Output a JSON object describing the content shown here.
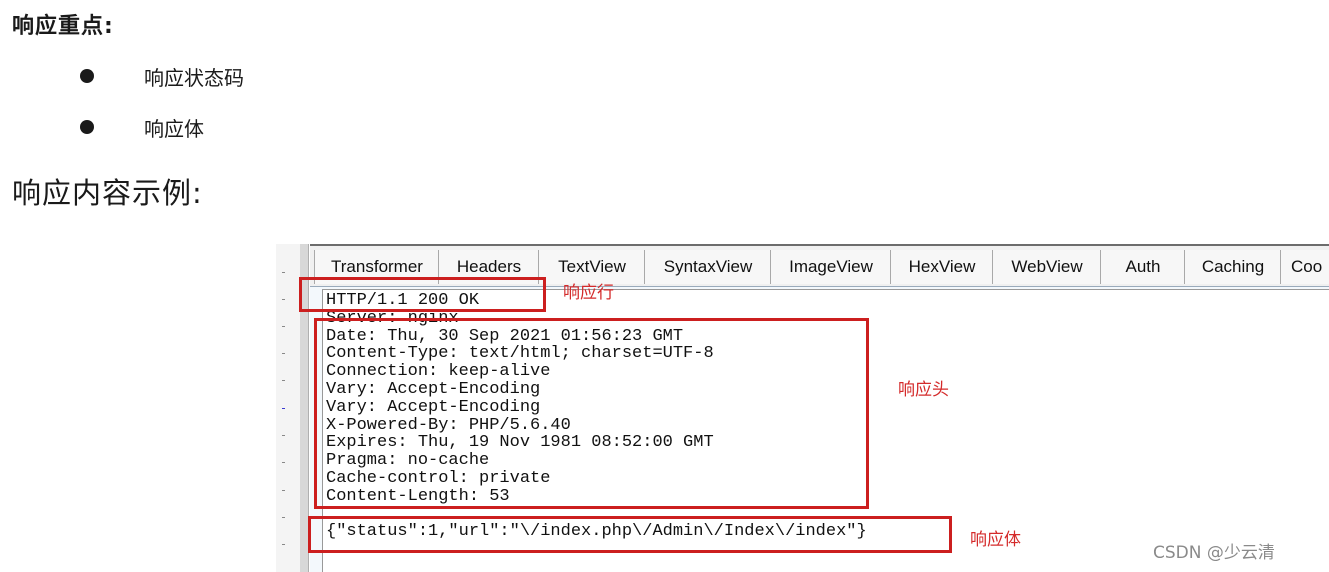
{
  "heading_bold": "响应重点:",
  "bullets": [
    "响应状态码",
    "响应体"
  ],
  "heading_large": "响应内容示例:",
  "tabs": [
    "Transformer",
    "Headers",
    "TextView",
    "SyntaxView",
    "ImageView",
    "HexView",
    "WebView",
    "Auth",
    "Caching",
    "Coo"
  ],
  "response": {
    "status_line": "HTTP/1.1 200 OK",
    "header_lines": [
      "Server: nginx",
      "Date: Thu, 30 Sep 2021 01:56:23 GMT",
      "Content-Type: text/html; charset=UTF-8",
      "Connection: keep-alive",
      "Vary: Accept-Encoding",
      "Vary: Accept-Encoding",
      "X-Powered-By: PHP/5.6.40",
      "Expires: Thu, 19 Nov 1981 08:52:00 GMT",
      "Pragma: no-cache",
      "Cache-control: private",
      "Content-Length: 53"
    ],
    "body_line": "{\"status\":1,\"url\":\"\\/index.php\\/Admin\\/Index\\/index\"}"
  },
  "annotations": {
    "status_line_label": "响应行",
    "headers_label": "响应头",
    "body_label": "响应体",
    "color": "#cc1f1f"
  },
  "watermark": "CSDN @少云清"
}
